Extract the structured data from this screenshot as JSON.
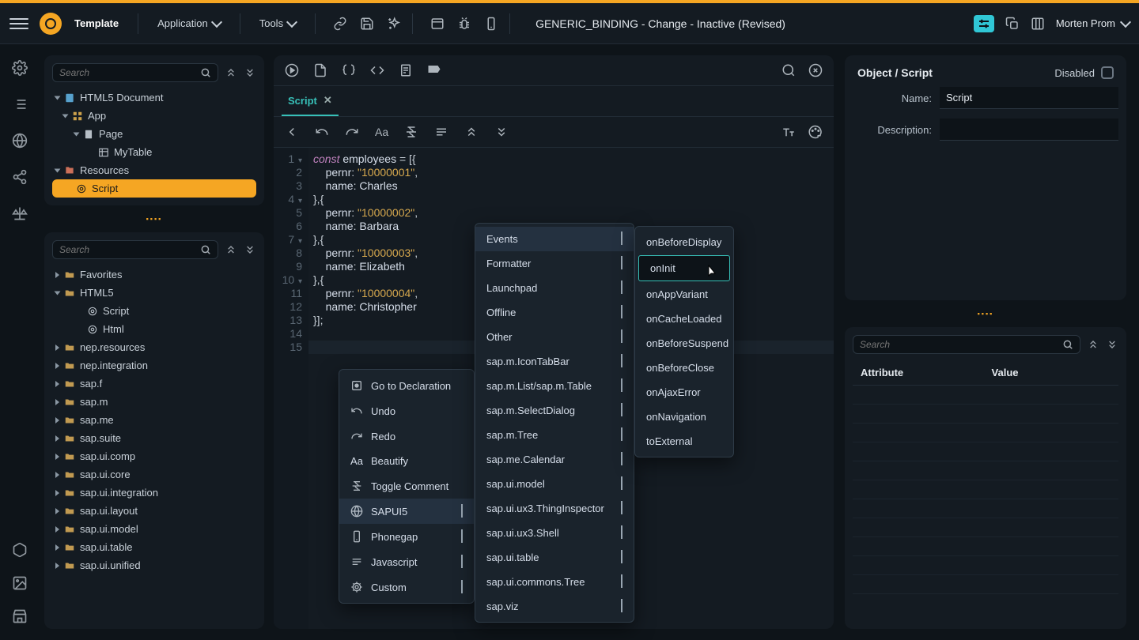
{
  "header": {
    "template_label": "Template",
    "app_label": "Application",
    "tools_label": "Tools",
    "title": "GENERIC_BINDING - Change - Inactive (Revised)",
    "user_name": "Morten Prom"
  },
  "tree_panel": {
    "search_placeholder": "Search",
    "root": "HTML5 Document",
    "app": "App",
    "page": "Page",
    "mytable": "MyTable",
    "resources": "Resources",
    "script": "Script"
  },
  "lib_panel": {
    "search_placeholder": "Search",
    "items": [
      {
        "label": "Favorites",
        "level": 1,
        "open": false
      },
      {
        "label": "HTML5",
        "level": 1,
        "open": true
      },
      {
        "label": "Script",
        "level": 2,
        "leaf": true
      },
      {
        "label": "Html",
        "level": 2,
        "leaf": true
      },
      {
        "label": "nep.resources",
        "level": 1,
        "open": false
      },
      {
        "label": "nep.integration",
        "level": 1,
        "open": false
      },
      {
        "label": "sap.f",
        "level": 1,
        "open": false
      },
      {
        "label": "sap.m",
        "level": 1,
        "open": false
      },
      {
        "label": "sap.me",
        "level": 1,
        "open": false
      },
      {
        "label": "sap.suite",
        "level": 1,
        "open": false
      },
      {
        "label": "sap.ui.comp",
        "level": 1,
        "open": false
      },
      {
        "label": "sap.ui.core",
        "level": 1,
        "open": false
      },
      {
        "label": "sap.ui.integration",
        "level": 1,
        "open": false
      },
      {
        "label": "sap.ui.layout",
        "level": 1,
        "open": false
      },
      {
        "label": "sap.ui.model",
        "level": 1,
        "open": false
      },
      {
        "label": "sap.ui.table",
        "level": 1,
        "open": false
      },
      {
        "label": "sap.ui.unified",
        "level": 1,
        "open": false
      }
    ]
  },
  "editor": {
    "tab_label": "Script",
    "line_numbers": [
      "1",
      "2",
      "3",
      "4",
      "5",
      "6",
      "7",
      "8",
      "9",
      "10",
      "11",
      "12",
      "13",
      "14",
      "15"
    ],
    "folds": {
      "1": true,
      "4": true,
      "7": true,
      "10": true
    },
    "employees": [
      {
        "pernr": "10000001",
        "name": "Charles"
      },
      {
        "pernr": "10000002",
        "name": "Barbara"
      },
      {
        "pernr": "10000003",
        "name": "Elizabeth"
      },
      {
        "pernr": "10000004",
        "name": "Christopher"
      }
    ]
  },
  "context_menu_1": {
    "items": [
      {
        "label": "Go to Declaration",
        "icon": "target"
      },
      {
        "label": "Undo",
        "icon": "undo"
      },
      {
        "label": "Redo",
        "icon": "redo"
      },
      {
        "label": "Beautify",
        "icon": "aa"
      },
      {
        "label": "Toggle Comment",
        "icon": "comment"
      },
      {
        "label": "SAPUI5",
        "icon": "globe",
        "sub": true,
        "hov": true
      },
      {
        "label": "Phonegap",
        "icon": "phone",
        "sub": true
      },
      {
        "label": "Javascript",
        "icon": "lines",
        "sub": true
      },
      {
        "label": "Custom",
        "icon": "gear",
        "sub": true
      }
    ]
  },
  "context_menu_2": {
    "items": [
      {
        "label": "Events",
        "sub": true,
        "hov": true
      },
      {
        "label": "Formatter",
        "sub": true
      },
      {
        "label": "Launchpad",
        "sub": true
      },
      {
        "label": "Offline",
        "sub": true
      },
      {
        "label": "Other",
        "sub": true
      },
      {
        "label": "sap.m.IconTabBar",
        "sub": true
      },
      {
        "label": "sap.m.List/sap.m.Table",
        "sub": true
      },
      {
        "label": "sap.m.SelectDialog",
        "sub": true
      },
      {
        "label": "sap.m.Tree",
        "sub": true
      },
      {
        "label": "sap.me.Calendar",
        "sub": true
      },
      {
        "label": "sap.ui.model",
        "sub": true
      },
      {
        "label": "sap.ui.ux3.ThingInspector",
        "sub": true
      },
      {
        "label": "sap.ui.ux3.Shell",
        "sub": true
      },
      {
        "label": "sap.ui.table",
        "sub": true
      },
      {
        "label": "sap.ui.commons.Tree",
        "sub": true
      },
      {
        "label": "sap.viz",
        "sub": true
      }
    ]
  },
  "context_menu_3": {
    "items": [
      {
        "label": "onBeforeDisplay"
      },
      {
        "label": "onInit",
        "hl": true
      },
      {
        "label": "onAppVariant"
      },
      {
        "label": "onCacheLoaded"
      },
      {
        "label": "onBeforeSuspend"
      },
      {
        "label": "onBeforeClose"
      },
      {
        "label": "onAjaxError"
      },
      {
        "label": "onNavigation"
      },
      {
        "label": "toExternal"
      }
    ]
  },
  "object_panel": {
    "title": "Object / Script",
    "disabled_label": "Disabled",
    "name_label": "Name:",
    "name_value": "Script",
    "desc_label": "Description:",
    "desc_value": ""
  },
  "attr_panel": {
    "search_placeholder": "Search",
    "col1": "Attribute",
    "col2": "Value"
  }
}
